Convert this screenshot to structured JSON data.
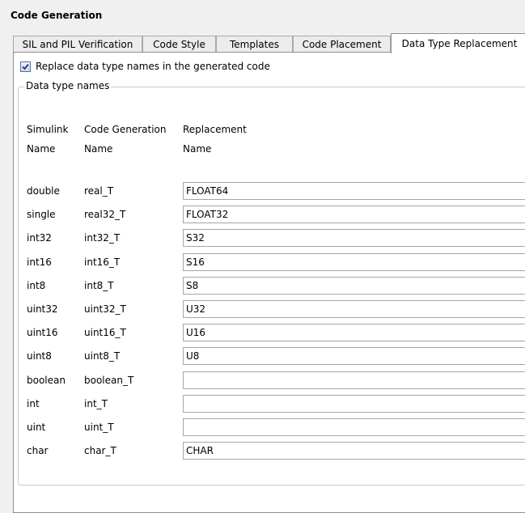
{
  "title": "Code Generation",
  "tabs": [
    {
      "label": "SIL and PIL Verification"
    },
    {
      "label": "Code Style"
    },
    {
      "label": "Templates"
    },
    {
      "label": "Code Placement"
    },
    {
      "label": "Data Type Replacement",
      "active": true
    }
  ],
  "replace_checkbox": {
    "checked": true,
    "label": "Replace data type names in the generated code"
  },
  "group_label": "Data type names",
  "headers": {
    "simulink": [
      "Simulink",
      "Name"
    ],
    "codegen": [
      "Code Generation",
      "Name"
    ],
    "replacement": [
      "Replacement",
      "Name"
    ]
  },
  "rows": [
    {
      "simulink": "double",
      "codegen": "real_T",
      "replacement": "FLOAT64"
    },
    {
      "simulink": "single",
      "codegen": "real32_T",
      "replacement": "FLOAT32"
    },
    {
      "simulink": "int32",
      "codegen": "int32_T",
      "replacement": "S32"
    },
    {
      "simulink": "int16",
      "codegen": "int16_T",
      "replacement": "S16"
    },
    {
      "simulink": "int8",
      "codegen": "int8_T",
      "replacement": "S8"
    },
    {
      "simulink": "uint32",
      "codegen": "uint32_T",
      "replacement": "U32"
    },
    {
      "simulink": "uint16",
      "codegen": "uint16_T",
      "replacement": "U16"
    },
    {
      "simulink": "uint8",
      "codegen": "uint8_T",
      "replacement": "U8"
    },
    {
      "simulink": "boolean",
      "codegen": "boolean_T",
      "replacement": ""
    },
    {
      "simulink": "int",
      "codegen": "int_T",
      "replacement": ""
    },
    {
      "simulink": "uint",
      "codegen": "uint_T",
      "replacement": ""
    },
    {
      "simulink": "char",
      "codegen": "char_T",
      "replacement": "CHAR"
    }
  ]
}
